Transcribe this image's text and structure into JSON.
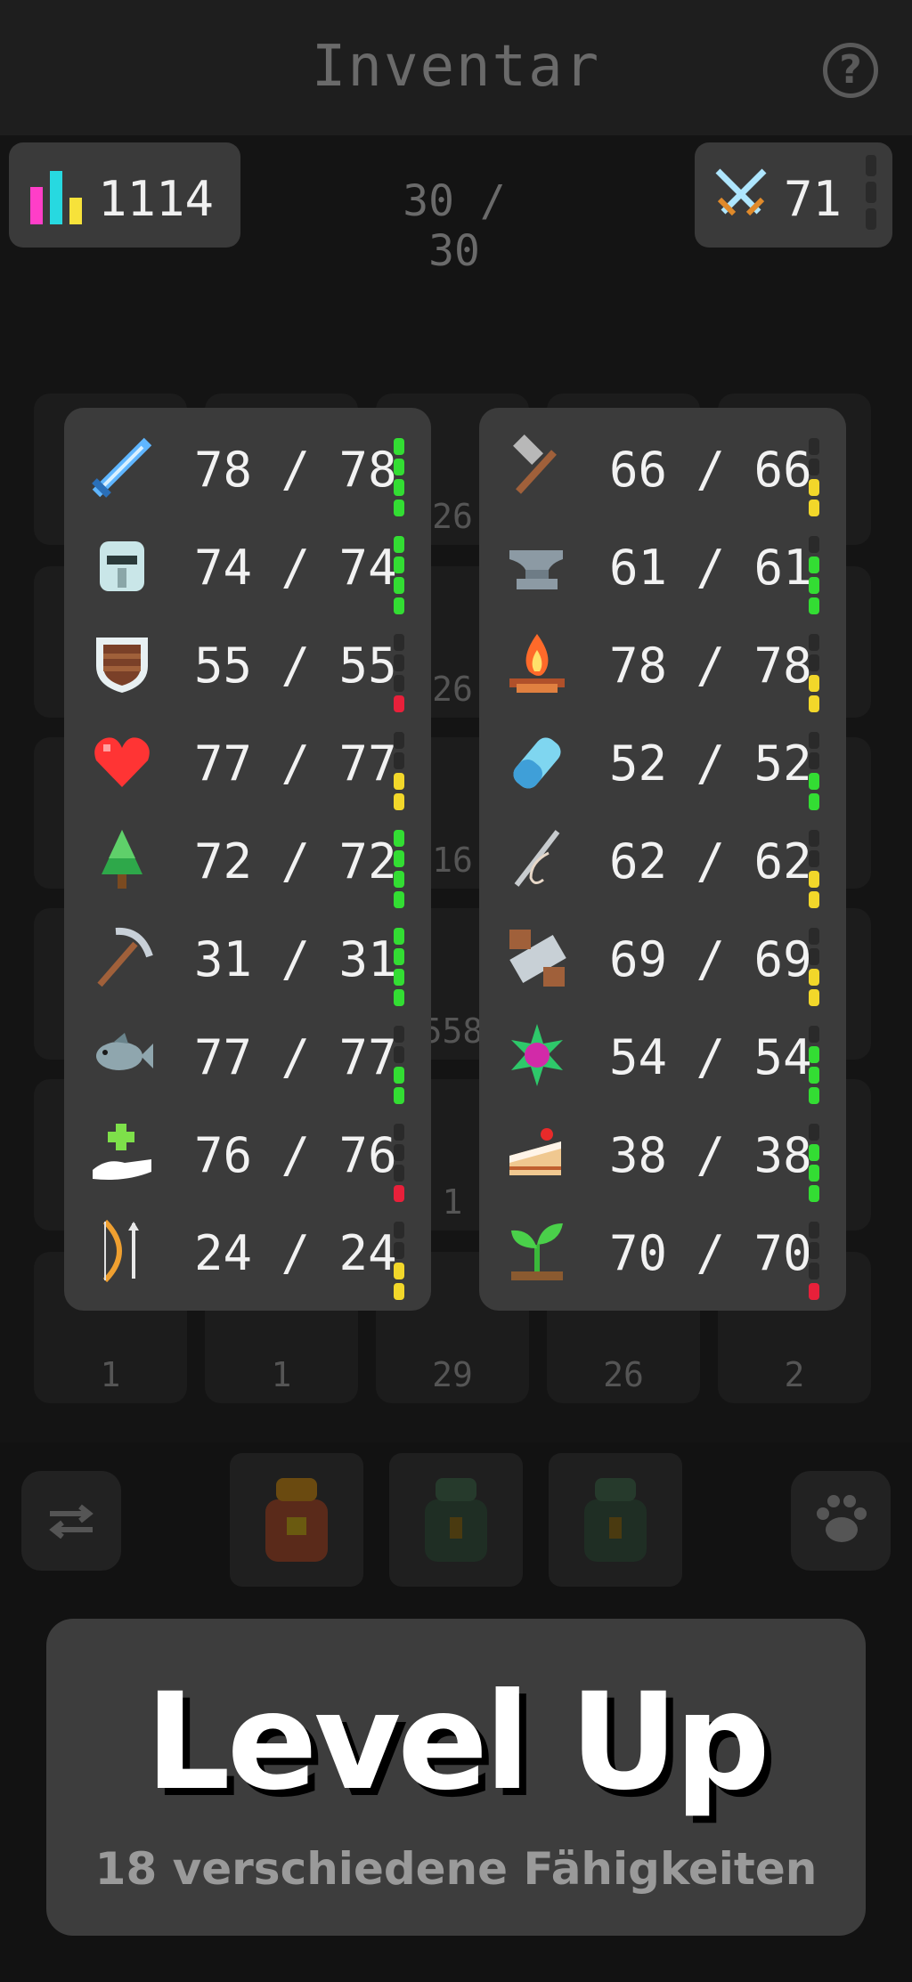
{
  "header": {
    "title": "Inventar",
    "help_icon": "question-icon"
  },
  "top_stats": {
    "total_level": "1114",
    "capacity": "30 / 30",
    "combat_level": "71"
  },
  "background_grid": {
    "visible_counts": [
      "26",
      "26",
      "16",
      "558",
      "1",
      "1",
      "1",
      "29",
      "26",
      "2"
    ]
  },
  "left_skills": [
    {
      "icon": "sword-icon",
      "value": "78 / 78",
      "meter": "green",
      "fill": 1.0
    },
    {
      "icon": "helmet-icon",
      "value": "74 / 74",
      "meter": "green",
      "fill": 0.9
    },
    {
      "icon": "shield-icon",
      "value": "55 / 55",
      "meter": "red",
      "fill": 0.2
    },
    {
      "icon": "heart-icon",
      "value": "77 / 77",
      "meter": "yellow",
      "fill": 0.45
    },
    {
      "icon": "tree-icon",
      "value": "72 / 72",
      "meter": "green",
      "fill": 0.9
    },
    {
      "icon": "pickaxe-icon",
      "value": "31 / 31",
      "meter": "green",
      "fill": 0.95
    },
    {
      "icon": "fish-icon",
      "value": "77 / 77",
      "meter": "green",
      "fill": 0.6
    },
    {
      "icon": "healing-hand-icon",
      "value": "76 / 76",
      "meter": "red",
      "fill": 0.2
    },
    {
      "icon": "bow-icon",
      "value": "24 / 24",
      "meter": "yellow",
      "fill": 0.45
    }
  ],
  "right_skills": [
    {
      "icon": "hammer-icon",
      "value": "66 / 66",
      "meter": "yellow",
      "fill": 0.5
    },
    {
      "icon": "anvil-icon",
      "value": "61 / 61",
      "meter": "green",
      "fill": 0.65
    },
    {
      "icon": "campfire-icon",
      "value": "78 / 78",
      "meter": "yellow",
      "fill": 0.5
    },
    {
      "icon": "potion-icon",
      "value": "52 / 52",
      "meter": "green",
      "fill": 0.6
    },
    {
      "icon": "needle-icon",
      "value": "62 / 62",
      "meter": "yellow",
      "fill": 0.4
    },
    {
      "icon": "saw-icon",
      "value": "69 / 69",
      "meter": "yellow",
      "fill": 0.45
    },
    {
      "icon": "gem-flower-icon",
      "value": "54 / 54",
      "meter": "green",
      "fill": 0.7
    },
    {
      "icon": "cake-icon",
      "value": "38 / 38",
      "meter": "green",
      "fill": 0.8
    },
    {
      "icon": "sprout-icon",
      "value": "70 / 70",
      "meter": "red",
      "fill": 0.15
    }
  ],
  "colors": {
    "green": "#33dd33",
    "yellow": "#f2d72a",
    "red": "#e8203a",
    "track": "#2a2a2a"
  },
  "promo": {
    "title": "Level Up",
    "subtitle": "18 verschiedene Fähigkeiten"
  }
}
